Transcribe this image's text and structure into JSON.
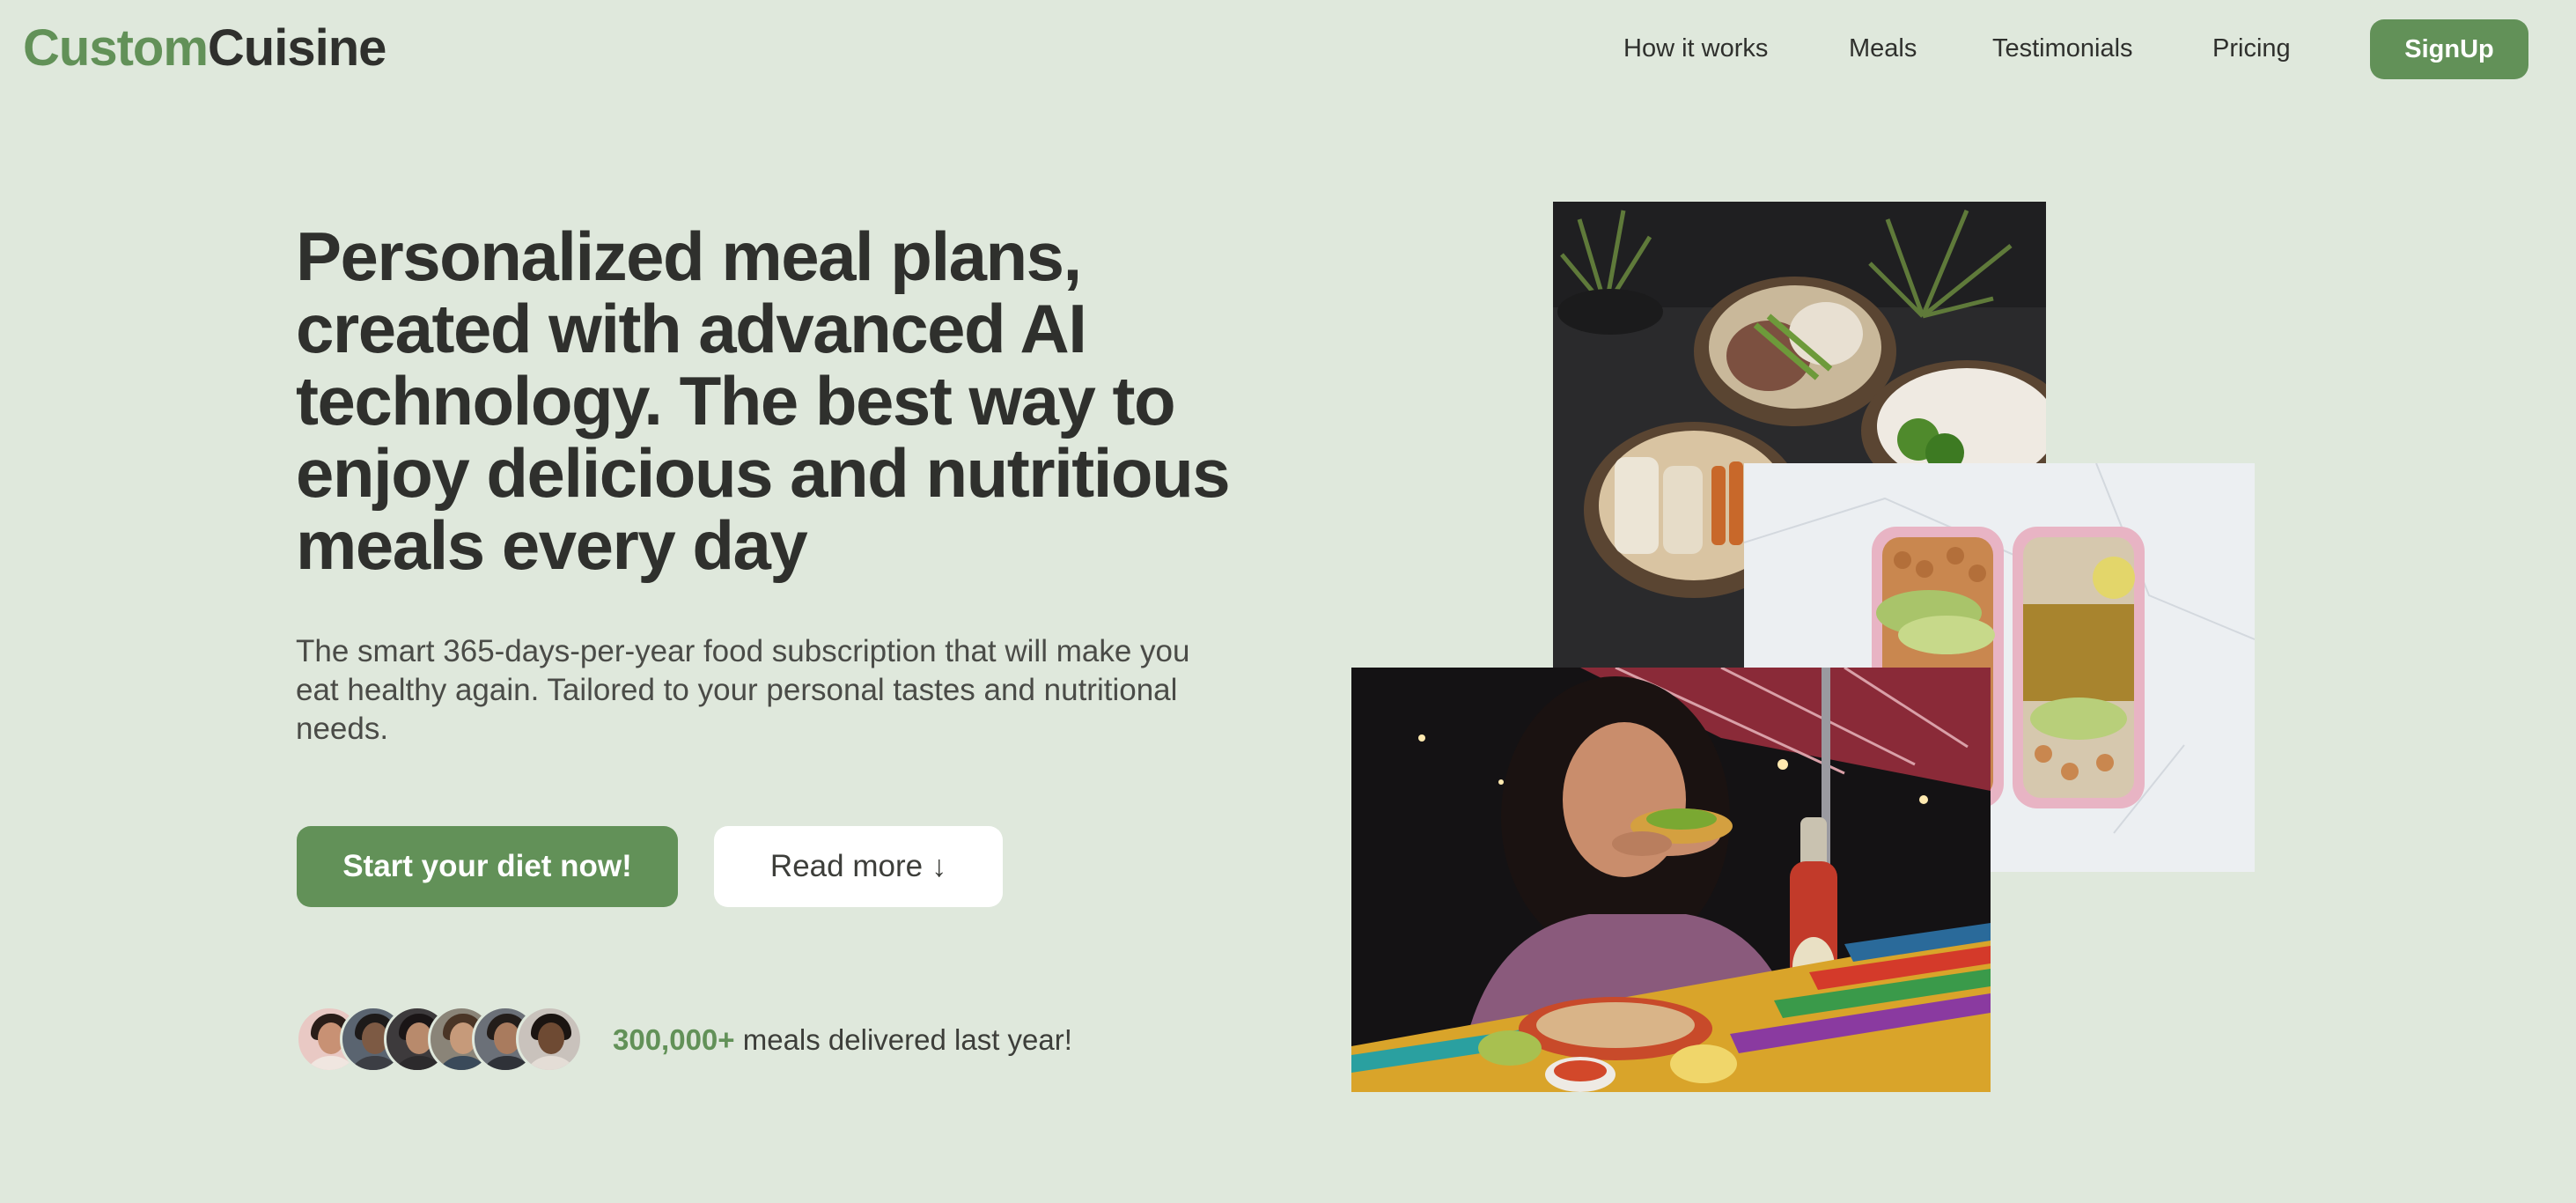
{
  "brand": {
    "name_part1": "Custom",
    "name_part2": "Cuisine"
  },
  "nav": {
    "items": [
      {
        "label": "How it works"
      },
      {
        "label": "Meals"
      },
      {
        "label": "Testimonials"
      },
      {
        "label": "Pricing"
      }
    ],
    "signup_label": "SignUp"
  },
  "hero": {
    "title": "Personalized meal plans, created with advanced AI technology. The best way to enjoy delicious and nutritious meals every day",
    "description": "The smart 365-days-per-year food subscription that will make you eat healthy again. Tailored to your personal tastes and nutritional needs.",
    "cta_primary": "Start your diet now!",
    "cta_secondary": "Read more",
    "cta_secondary_icon": "arrow-down-icon",
    "cta_secondary_arrow": "↓"
  },
  "social_proof": {
    "count": "300,000+",
    "text": " meals delivered last year!"
  },
  "colors": {
    "background": "#dfe8dc",
    "brand_green": "#629158",
    "text_dark": "#2f302d"
  }
}
